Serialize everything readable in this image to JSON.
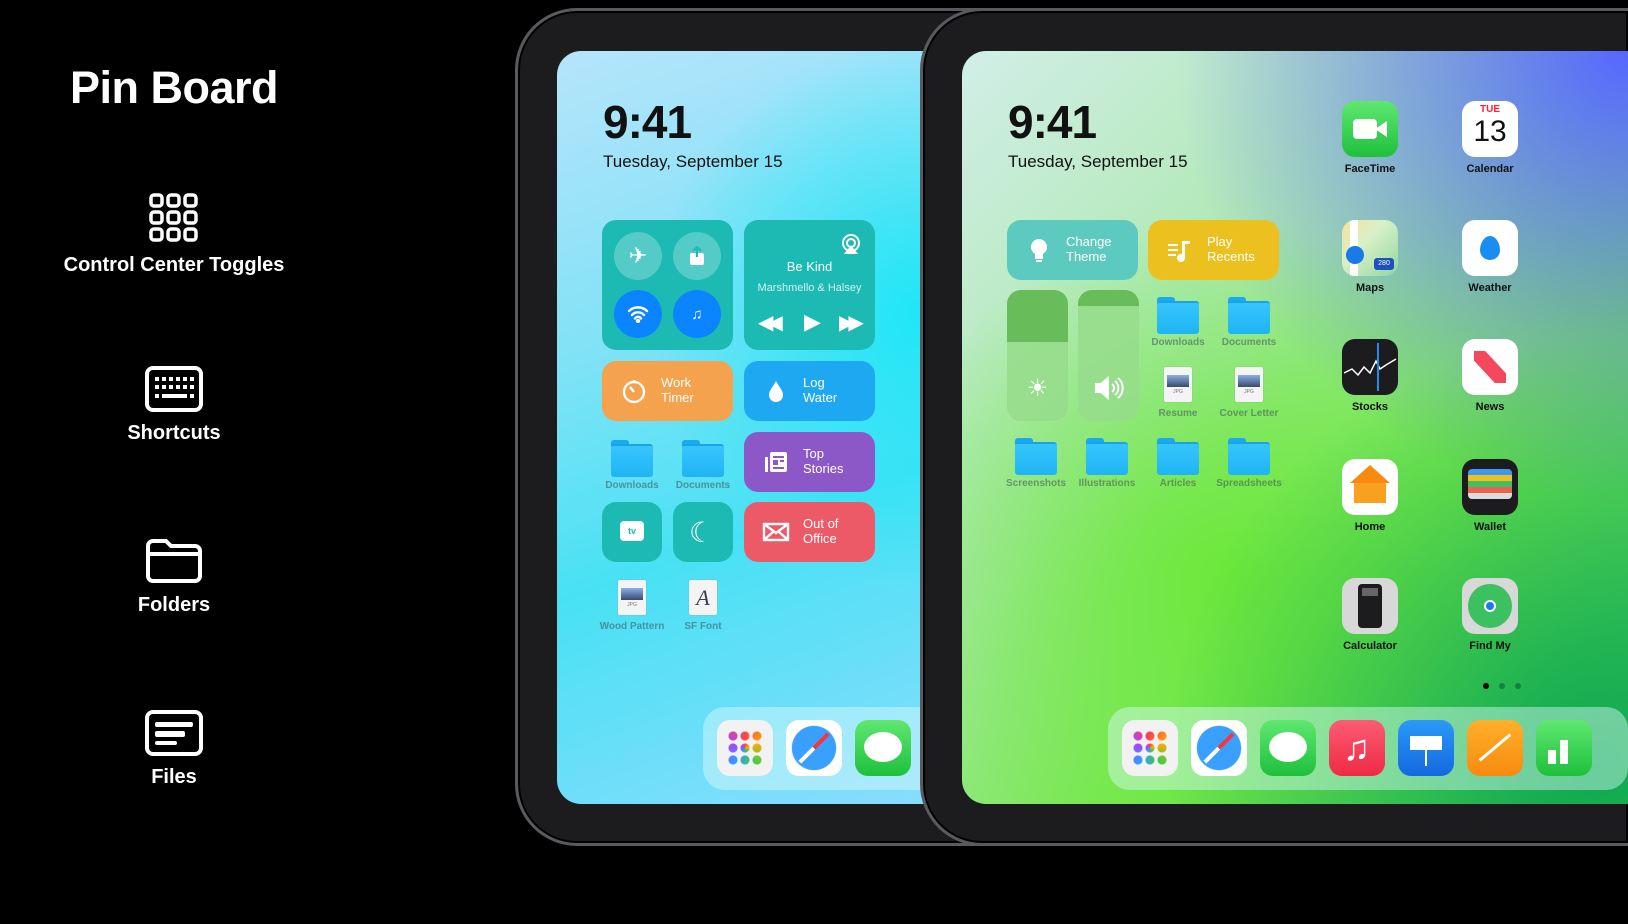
{
  "left_panel": {
    "title": "Pin Board",
    "features": [
      {
        "label": "Control Center Toggles",
        "icon": "grid-icon"
      },
      {
        "label": "Shortcuts",
        "icon": "keyboard-icon"
      },
      {
        "label": "Folders",
        "icon": "folder-icon"
      },
      {
        "label": "Files",
        "icon": "files-icon"
      }
    ]
  },
  "ipad1": {
    "time": "9:41",
    "date": "Tuesday, September 15",
    "now_playing": {
      "title": "Be Kind",
      "artist": "Marshmello & Halsey"
    },
    "toggles": [
      "airplane-icon",
      "share-icon",
      "wifi-icon",
      "airpods-icon"
    ],
    "shortcuts": {
      "work_timer": {
        "label": "Work\nTimer",
        "color": "#f5a24e"
      },
      "log_water": {
        "label": "Log\nWater",
        "color": "#1ea8f2"
      },
      "top_stories": {
        "label": "Top\nStories",
        "color": "#8c58c8"
      },
      "out_of_office": {
        "label": "Out of\nOffice",
        "color": "#ec5a68"
      }
    },
    "folders": [
      "Downloads",
      "Documents"
    ],
    "files": [
      {
        "name": "Wood Pattern",
        "type": "JPG"
      },
      {
        "name": "SF Font",
        "type": "A"
      }
    ],
    "dock": [
      "launchpad",
      "safari",
      "messages"
    ]
  },
  "ipad2": {
    "time": "9:41",
    "date": "Tuesday, September 15",
    "shortcuts": {
      "change_theme": {
        "label": "Change\nTheme",
        "color": "#5ccabe"
      },
      "play_recents": {
        "label": "Play\nRecents",
        "color": "#ecc01e"
      }
    },
    "brightness_level": 0.6,
    "volume_level": 0.88,
    "folders_top": [
      "Downloads",
      "Documents"
    ],
    "files": [
      {
        "name": "Resume",
        "type": "JPG"
      },
      {
        "name": "Cover Letter",
        "type": "JPG"
      }
    ],
    "folders_bottom": [
      "Screenshots",
      "Illustrations",
      "Articles",
      "Spreadsheets"
    ],
    "apps": [
      {
        "label": "FaceTime"
      },
      {
        "label": "Calendar",
        "day": "TUE",
        "date": "13"
      },
      {
        "label": "Maps",
        "badge": "280"
      },
      {
        "label": "Weather"
      },
      {
        "label": "Stocks"
      },
      {
        "label": "News"
      },
      {
        "label": "Home"
      },
      {
        "label": "Wallet"
      },
      {
        "label": "Calculator"
      },
      {
        "label": "Find My"
      }
    ],
    "page_count": 3,
    "current_page": 1,
    "dock": [
      "launchpad",
      "safari",
      "messages",
      "music",
      "keynote",
      "pages",
      "numbers"
    ]
  }
}
